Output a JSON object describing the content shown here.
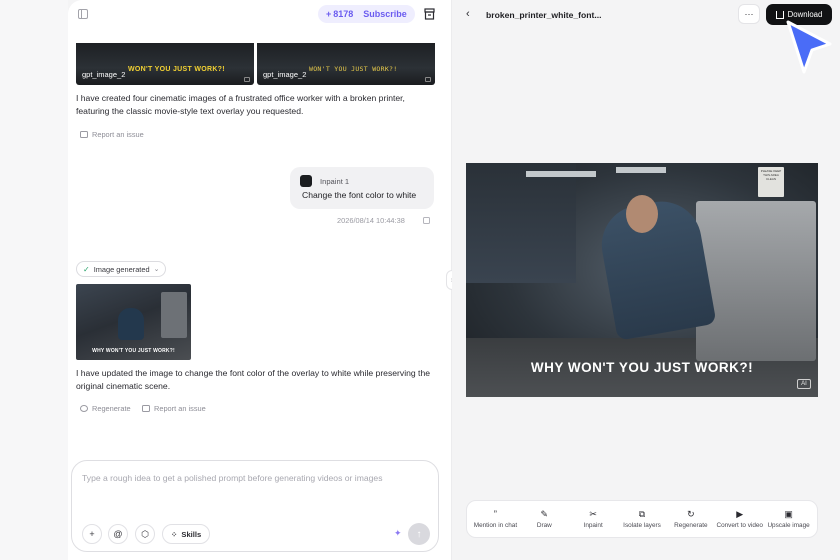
{
  "header": {
    "credits": "8178",
    "subscribe_label": "Subscribe"
  },
  "chat": {
    "thumbnails": [
      {
        "tag": "gpt_image_2",
        "caption": "WON'T YOU JUST WORK?!"
      },
      {
        "tag": "gpt_image_2",
        "caption": "WON'T YOU JUST WORK?!"
      }
    ],
    "assistant_message_1": "I have created four cinematic images of a frustrated office worker with a broken printer, featuring the classic movie-style text overlay you requested.",
    "report_issue_label": "Report an issue",
    "user_message": {
      "reference": "Inpaint 1",
      "text": "Change the font color to white",
      "timestamp": "2026/08/14 10:44:38"
    },
    "generated_chip": "Image generated",
    "result_caption": "WHY WON'T YOU JUST WORK?!",
    "assistant_message_2": "I have updated the image to change the font color of the overlay to white while preserving the original cinematic scene.",
    "regenerate_label": "Regenerate",
    "report_issue_label_2": "Report an issue"
  },
  "composer": {
    "placeholder": "Type a rough idea to get a polished prompt before generating videos or images",
    "skills_label": "Skills"
  },
  "viewer": {
    "file_name": "broken_printer_white_font...",
    "download_label": "Download",
    "image_caption": "WHY WON'T YOU JUST WORK?!",
    "ai_badge": "AI",
    "sign_text": "PLEASE KEEP THIS AREA CLEAN"
  },
  "toolbar": {
    "items": [
      {
        "label": "Mention in chat",
        "icon": "quote-icon"
      },
      {
        "label": "Draw",
        "icon": "brush-icon"
      },
      {
        "label": "Inpaint",
        "icon": "scissors-icon"
      },
      {
        "label": "Isolate layers",
        "icon": "layers-icon"
      },
      {
        "label": "Regenerate",
        "icon": "refresh-icon"
      },
      {
        "label": "Convert to video",
        "icon": "video-icon"
      },
      {
        "label": "Upscale image",
        "icon": "hd-icon"
      }
    ]
  },
  "colors": {
    "accent": "#6b5cf0",
    "cursor": "#4a6cf7",
    "download_bg": "#111214"
  }
}
